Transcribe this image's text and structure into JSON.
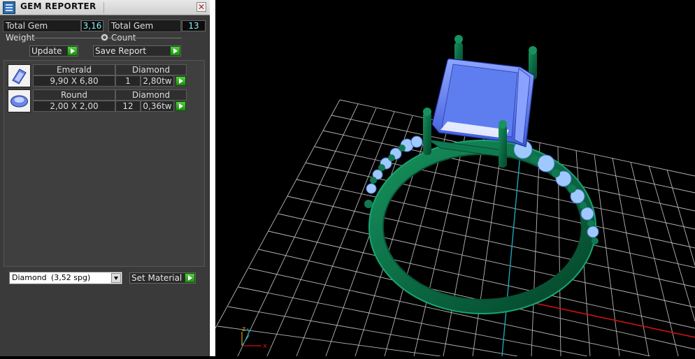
{
  "window": {
    "title": "GEM REPORTER",
    "close_glyph": "✕"
  },
  "totals": {
    "weight_label": "Total Gem Weight",
    "weight_value": "3,16",
    "count_label": "Total Gem Count",
    "count_value": "13"
  },
  "actions": {
    "update_label": "Update",
    "save_report_label": "Save Report"
  },
  "gems": [
    {
      "shape": "Emerald",
      "dimensions": "9,90 X 6,80",
      "material": "Diamond",
      "count": "1",
      "weight": "2,80tw",
      "thumb_icon": "emerald-gem-icon"
    },
    {
      "shape": "Round",
      "dimensions": "2,00 X 2,00",
      "material": "Diamond",
      "count": "12",
      "weight": "0,36tw",
      "thumb_icon": "round-gem-icon"
    }
  ],
  "material_select": {
    "selected_name": "Diamond",
    "selected_density": "(3,52 spg)",
    "set_material_label": "Set Material"
  },
  "viewport": {
    "axis_x_label": "x",
    "axis_y_label": "y",
    "axis_z_label": "z"
  },
  "colors": {
    "panel_bg": "#3a3a3a",
    "accent_green": "#2faa1f",
    "value_text": "#8ef0ff",
    "ring_metal": "#0f6a44",
    "gem_blue": "#4a6ce8",
    "grid_line": "#d8d8d8",
    "x_axis": "#d01010",
    "y_axis": "#1aa8b8"
  }
}
